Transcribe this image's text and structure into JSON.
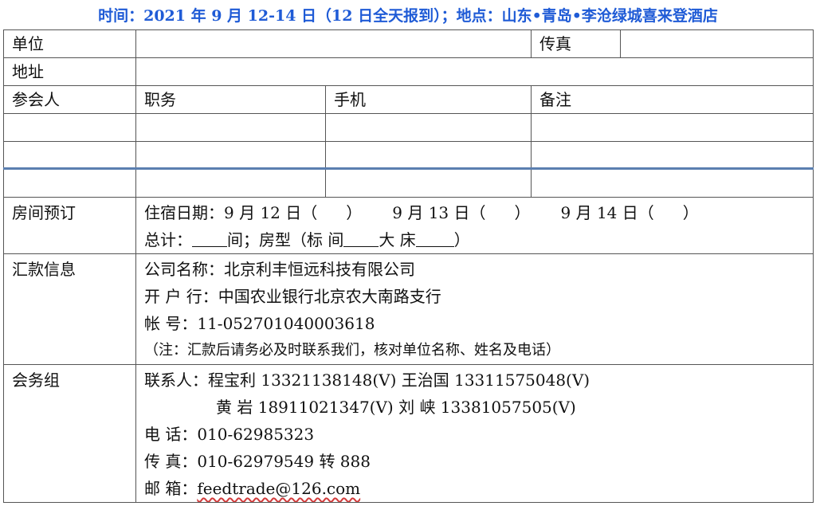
{
  "header": {
    "text": "时间：2021 年 9 月 12-14 日（12 日全天报到）；地点：山东•青岛•李沧绿城喜来登酒店"
  },
  "labels": {
    "unit": "单位",
    "fax": "传真",
    "address": "地址",
    "attendee": "参会人",
    "position": "职务",
    "mobile": "手机",
    "remark": "备注",
    "room_booking": "房间预订",
    "remittance": "汇款信息",
    "service_group": "会务组"
  },
  "room": {
    "stay_dates_label": "住宿日期：",
    "dates": [
      "9 月 12 日（",
      "）",
      "9 月 13 日（",
      "）",
      "9 月 14 日（",
      "）"
    ],
    "total_label": "总计：",
    "total_unit": "间；房型（标  间",
    "big_bed": "大  床",
    "close_paren": "）"
  },
  "remittance": {
    "company_label": "公司名称：",
    "company_value": "北京利丰恒远科技有限公司",
    "bank_label": "开  户  行：",
    "bank_value": "中国农业银行北京农大南路支行",
    "account_label": "帐      号：",
    "account_value": "11-052701040003618",
    "note": "（注：汇款后请务必及时联系我们，核对单位名称、姓名及电话）"
  },
  "service": {
    "contact_label": "联系人：",
    "contact_line1": "程宝利 13321138148(V)    王治国 13311575048(V)",
    "contact_line2": "黄    岩 18911021347(V)    刘    峡 13381057505(V)",
    "phone_label": "电    话：",
    "phone_value": "010-62985323",
    "fax_label": "传    真：",
    "fax_value": "010-62979549 转 888",
    "email_label": "邮    箱：",
    "email_value": "feedtrade@126.com"
  },
  "colors": {
    "header": "#1f5bd6",
    "border": "#555555",
    "separator": "#5b7fb0",
    "spell_underline": "#d23a3a"
  }
}
